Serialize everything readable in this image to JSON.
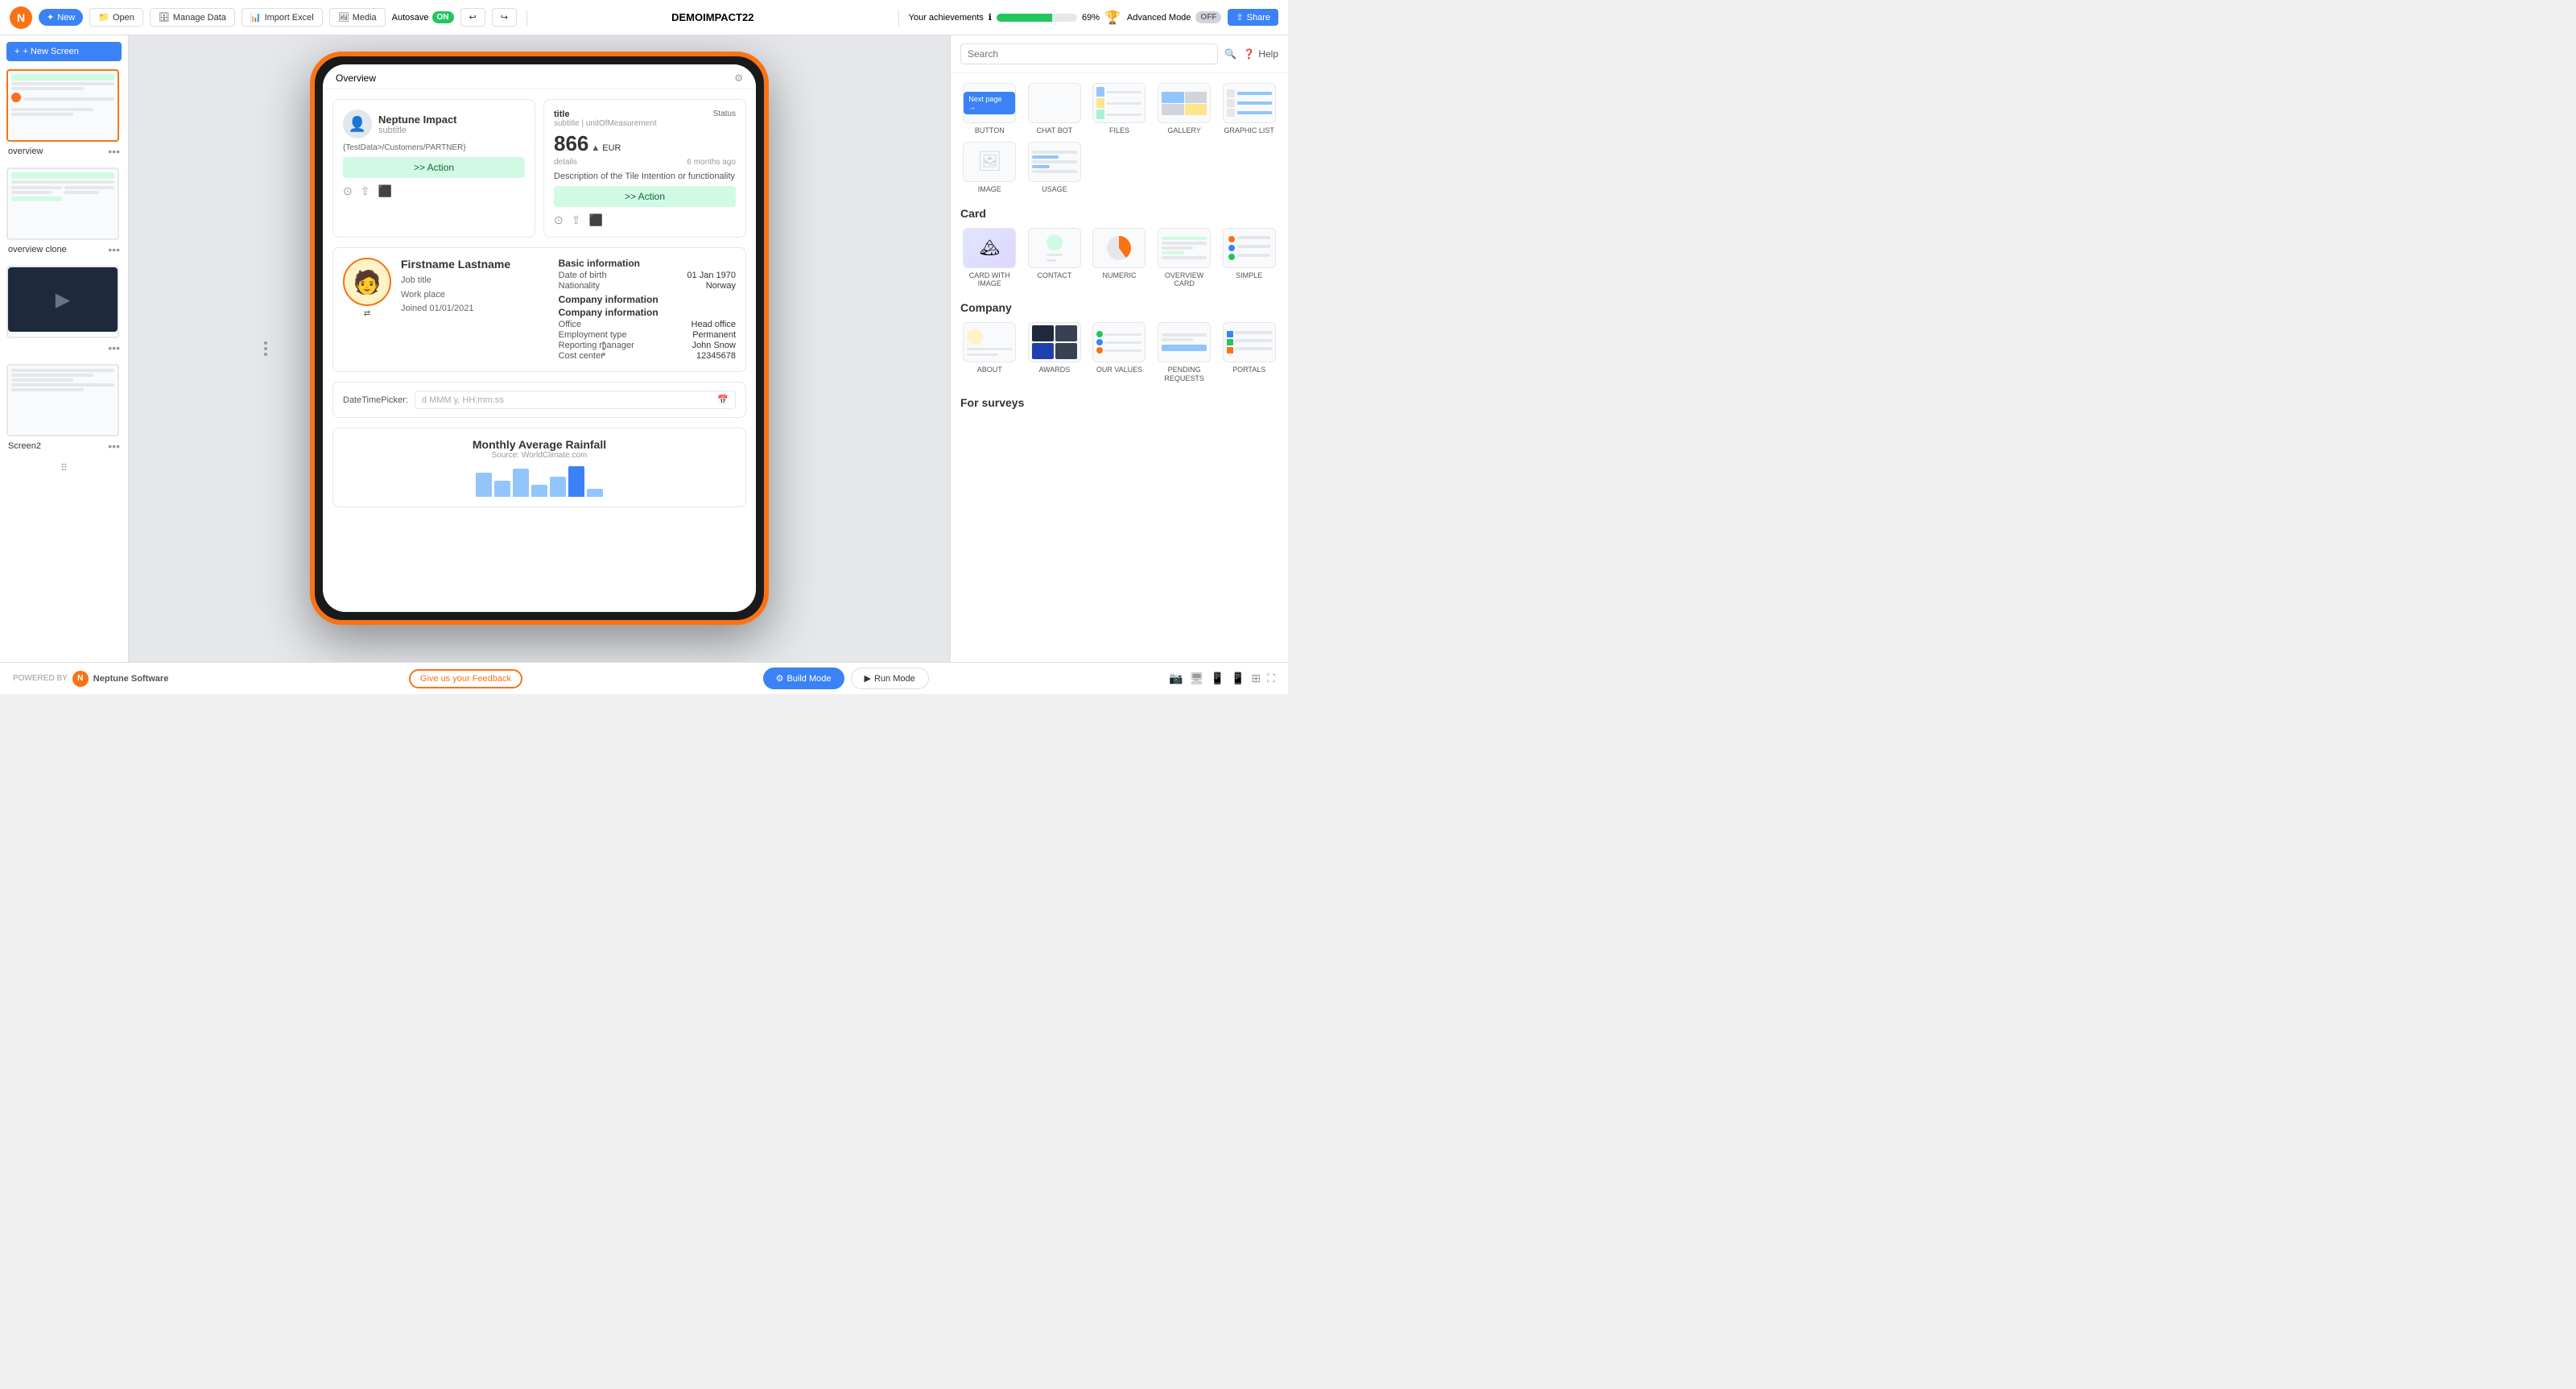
{
  "topbar": {
    "logo": "N",
    "new_label": "New",
    "open_label": "Open",
    "manage_data_label": "Manage Data",
    "import_excel_label": "Import Excel",
    "media_label": "Media",
    "autosave_label": "Autosave",
    "autosave_state": "ON",
    "project_name": "DEMOIMPACT22",
    "achievements_label": "Your achievements",
    "progress_percent": "69%",
    "progress_value": 69,
    "advanced_mode_label": "Advanced Mode",
    "advanced_mode_state": "OFF",
    "share_label": "Share"
  },
  "sidebar": {
    "new_screen_label": "+ New Screen",
    "screens": [
      {
        "label": "overview",
        "active": true
      },
      {
        "label": "overview clone",
        "active": false
      },
      {
        "label": "",
        "active": false
      },
      {
        "label": "Screen2",
        "active": false
      }
    ]
  },
  "canvas": {
    "device_title": "Overview",
    "contact_card": {
      "name": "Neptune Impact",
      "subtitle": "subtitle",
      "data_path": "{TestData>/Customers/PARTNER}",
      "action_label": ">> Action"
    },
    "metric_card": {
      "title": "title",
      "subtitle": "subtitle | unitOfMeasurement",
      "status": "Status",
      "value": "866",
      "unit": "EUR",
      "details": "details",
      "time_ago": "6 months ago",
      "description": "Description of the Tile Intention or functionality",
      "action_label": ">> Action"
    },
    "profile": {
      "name": "Firstname Lastname",
      "job_title": "Job title",
      "work_place": "Work place",
      "joined": "Joined 01/01/2021",
      "basic_info_title": "Basic information",
      "dob_label": "Date of birth",
      "dob_value": "01 Jan 1970",
      "nationality_label": "Nationality",
      "nationality_value": "Norway",
      "company_info_title": "Company information",
      "company_info2_title": "Company information",
      "office_label": "Office",
      "office_value": "Head office",
      "employment_label": "Employment type",
      "employment_value": "Permanent",
      "manager_label": "Reporting manager",
      "manager_value": "John Snow",
      "cost_label": "Cost center",
      "cost_value": "12345678"
    },
    "datetime": {
      "label": "DateTimePicker:",
      "placeholder": "d MMM y, HH:mm:ss"
    },
    "chart": {
      "title": "Monthly Average Rainfall",
      "source": "Source: WorldClimate.com"
    }
  },
  "right_panel": {
    "search_placeholder": "Search",
    "help_label": "Help",
    "sections": [
      {
        "title": "",
        "items": [
          {
            "label": "BUTTON",
            "type": "button"
          },
          {
            "label": "CHAT BOT",
            "type": "chatbot"
          },
          {
            "label": "FILES",
            "type": "files"
          },
          {
            "label": "GALLERY",
            "type": "gallery"
          },
          {
            "label": "GRAPHIC LIST",
            "type": "graphiclist"
          },
          {
            "label": "IMAGE",
            "type": "image"
          },
          {
            "label": "USAGE",
            "type": "usage"
          }
        ]
      },
      {
        "title": "Card",
        "items": [
          {
            "label": "CARD WITH IMAGE",
            "type": "cardimage"
          },
          {
            "label": "CONTACT",
            "type": "contact"
          },
          {
            "label": "NUMERIC",
            "type": "numeric"
          },
          {
            "label": "OVERVIEW CARD",
            "type": "overviewcard"
          },
          {
            "label": "SIMPLE",
            "type": "simple"
          }
        ]
      },
      {
        "title": "Company",
        "items": [
          {
            "label": "ABOUT",
            "type": "about"
          },
          {
            "label": "AWARDS",
            "type": "awards"
          },
          {
            "label": "OUR VALUES",
            "type": "ourvalues"
          },
          {
            "label": "PENDING REQUESTS",
            "type": "pendingreqs"
          },
          {
            "label": "PORTALS",
            "type": "portals"
          }
        ]
      },
      {
        "title": "For surveys",
        "items": []
      }
    ]
  },
  "bottombar": {
    "powered_by": "POWERED BY",
    "company_name": "Neptune Software",
    "feedback_label": "Give us your Feedback",
    "build_mode_label": "Build Mode",
    "run_mode_label": "Run Mode"
  }
}
